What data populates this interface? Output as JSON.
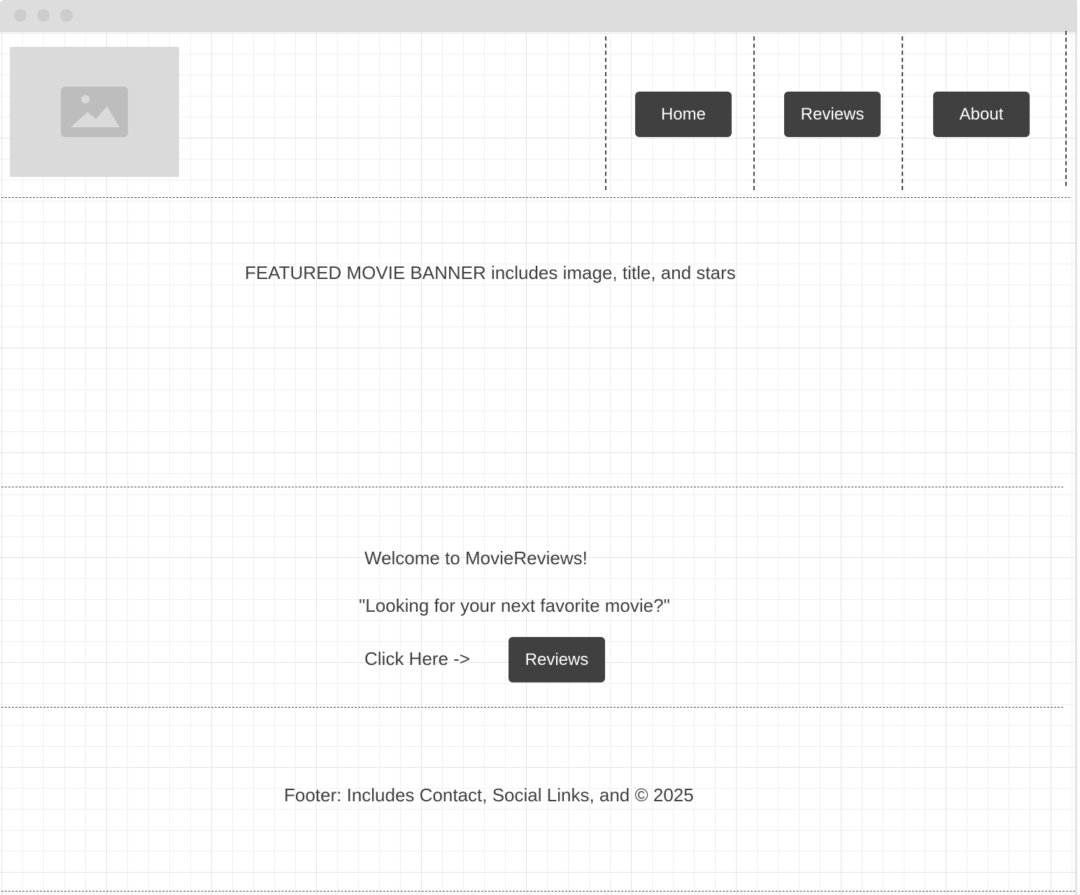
{
  "nav": {
    "home_label": "Home",
    "reviews_label": "Reviews",
    "about_label": "About"
  },
  "banner": {
    "text": "FEATURED MOVIE BANNER includes image, title, and stars"
  },
  "welcome": {
    "heading": "Welcome to MovieReviews!",
    "tagline": "\"Looking for your next favorite movie?\"",
    "cta_text": "Click Here ->",
    "cta_button_label": "Reviews"
  },
  "footer": {
    "text": "Footer: Includes Contact, Social Links, and © 2025"
  },
  "icons": {
    "logo_placeholder": "image-placeholder-icon"
  }
}
